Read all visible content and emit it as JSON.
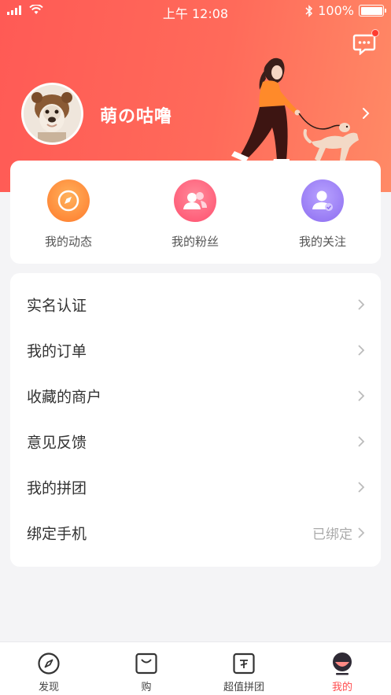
{
  "status_bar": {
    "time": "上午 12:08",
    "battery": "100%",
    "icons": [
      "signal-icon",
      "wifi-icon",
      "bluetooth-icon",
      "battery-icon"
    ]
  },
  "profile": {
    "username": "萌の咕噜",
    "avatar_icon": "dog-avatar",
    "header_illustration": "woman-walking-dog-illustration"
  },
  "header": {
    "message_icon": "message-icon",
    "has_unread": true
  },
  "quick_actions": [
    {
      "label": "我的动态",
      "icon": "compass-icon",
      "color": "#ff8a3d"
    },
    {
      "label": "我的粉丝",
      "icon": "fans-icon",
      "color": "#ff5a7a"
    },
    {
      "label": "我的关注",
      "icon": "follow-icon",
      "color": "#9b7cf2"
    }
  ],
  "menu": [
    {
      "label": "实名认证",
      "value": ""
    },
    {
      "label": "我的订单",
      "value": ""
    },
    {
      "label": "收藏的商户",
      "value": ""
    },
    {
      "label": "意见反馈",
      "value": ""
    },
    {
      "label": "我的拼团",
      "value": ""
    },
    {
      "label": "绑定手机",
      "value": "已绑定"
    }
  ],
  "tabs": [
    {
      "label": "发现",
      "icon": "discover-icon",
      "active": false
    },
    {
      "label": "购",
      "icon": "shopping-bag-icon",
      "active": false
    },
    {
      "label": "超值拼团",
      "icon": "group-buy-icon",
      "active": false
    },
    {
      "label": "我的",
      "icon": "profile-icon",
      "active": true
    }
  ],
  "colors": {
    "header_gradient_start": "#ff5a55",
    "header_gradient_end": "#ff8a66",
    "active_tab": "#ff4d4f",
    "background": "#f4f4f6"
  }
}
